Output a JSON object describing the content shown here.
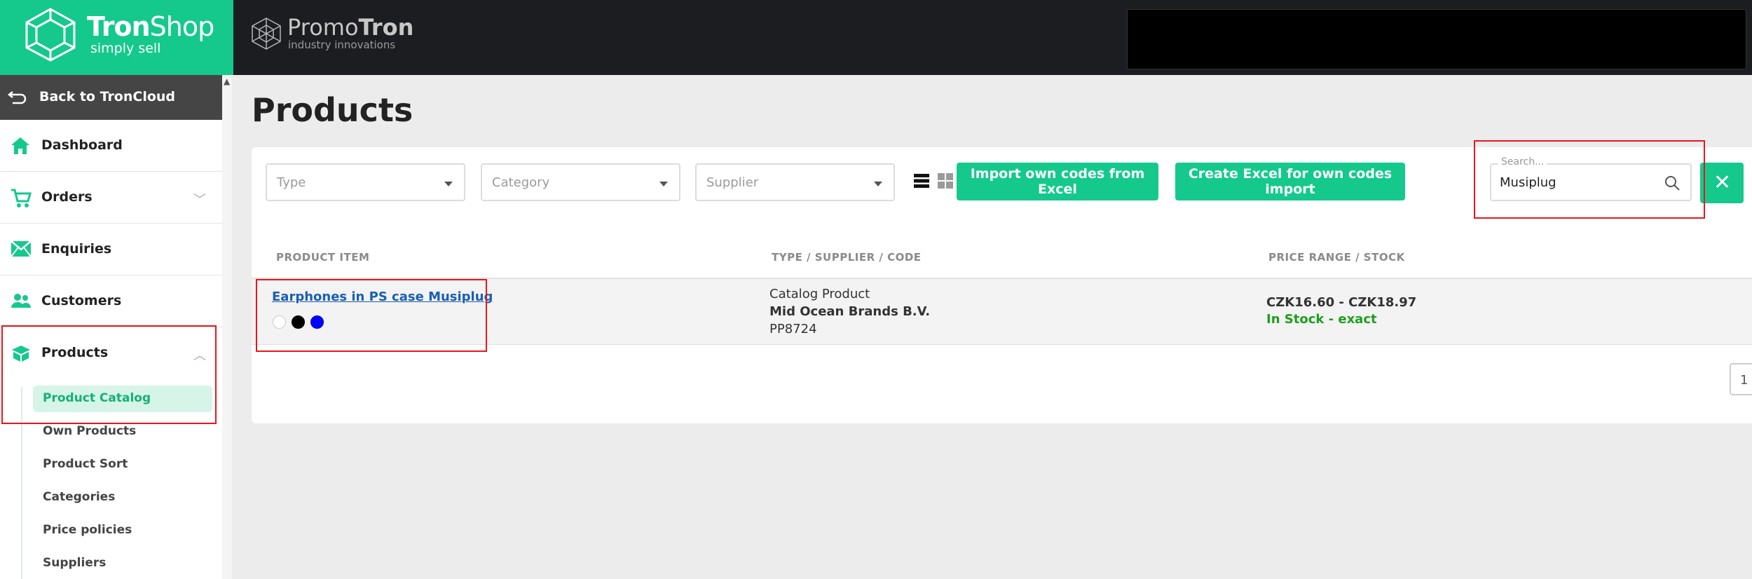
{
  "header": {
    "brand_bold": "Tron",
    "brand_light": "Shop",
    "brand_tagline": "simply sell",
    "partner_light": "Promo",
    "partner_bold": "Tron",
    "partner_tagline": "industry innovations"
  },
  "sidebar": {
    "back_label": "Back to TronCloud",
    "items": [
      {
        "label": "Dashboard",
        "icon": "home-icon"
      },
      {
        "label": "Orders",
        "icon": "cart-icon"
      },
      {
        "label": "Enquiries",
        "icon": "envelope-icon"
      },
      {
        "label": "Customers",
        "icon": "users-icon"
      },
      {
        "label": "Products",
        "icon": "box-icon"
      }
    ],
    "sub_items": [
      {
        "label": "Product Catalog",
        "active": true
      },
      {
        "label": "Own Products"
      },
      {
        "label": "Product Sort"
      },
      {
        "label": "Categories"
      },
      {
        "label": "Price policies"
      },
      {
        "label": "Suppliers"
      }
    ]
  },
  "main": {
    "title": "Products",
    "filters": {
      "type_placeholder": "Type",
      "category_placeholder": "Category",
      "supplier_placeholder": "Supplier"
    },
    "buttons": {
      "import_label": "Import own codes from Excel",
      "create_label": "Create Excel for own codes import",
      "clear_label": "✕"
    },
    "search": {
      "label": "Search...",
      "value": "Musiplug"
    },
    "table": {
      "columns": [
        "PRODUCT ITEM",
        "TYPE / SUPPLIER / CODE",
        "PRICE RANGE / STOCK"
      ],
      "rows": [
        {
          "name": "Earphones in PS case Musiplug",
          "colors": [
            "#ffffff",
            "#000000",
            "#0000ff"
          ],
          "type": "Catalog Product",
          "supplier": "Mid Ocean Brands B.V.",
          "code": "PP8724",
          "price": "CZK16.60 - CZK18.97",
          "stock": "In Stock - exact"
        }
      ]
    },
    "pagination": {
      "current": "1"
    }
  },
  "colors": {
    "accent": "#14c98b",
    "header_bg": "#1c1d20",
    "link": "#1a5fb4",
    "stock_ok": "#1e9e1e",
    "highlight": "#e8161c"
  }
}
